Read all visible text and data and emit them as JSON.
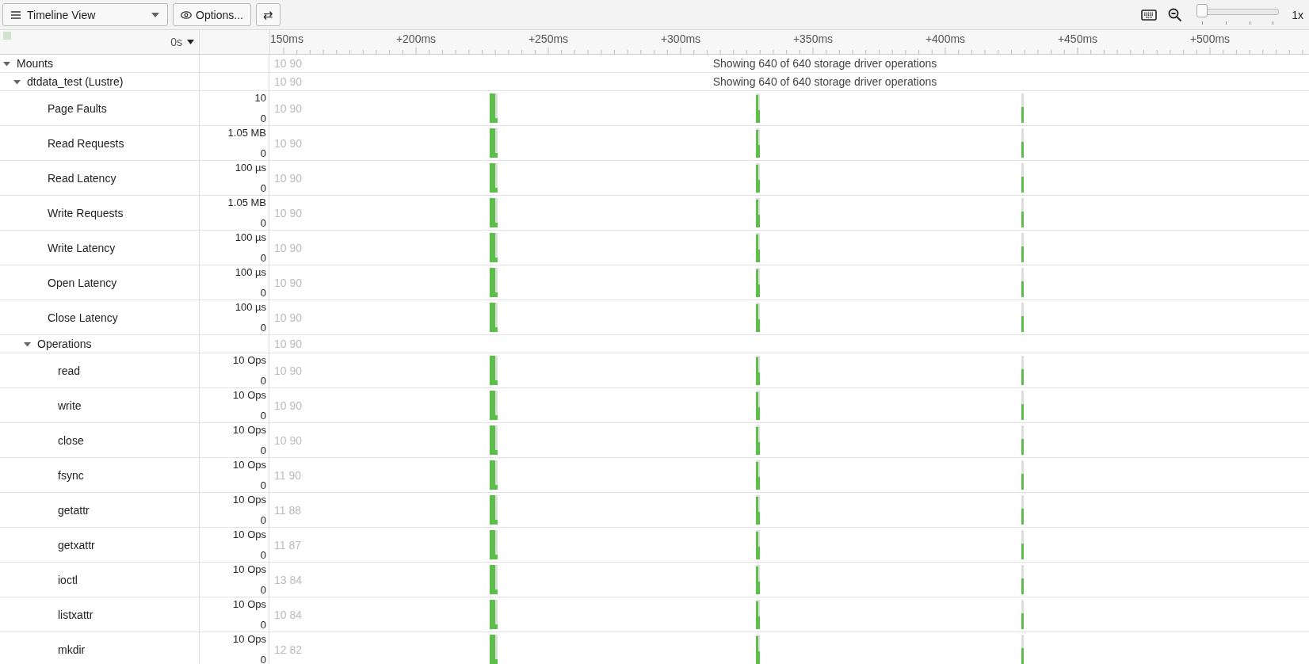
{
  "toolbar": {
    "view_select": "Timeline View",
    "options_button": "Options...",
    "swap_button": "⇄",
    "zoom": {
      "level": 0,
      "reading": "1x"
    }
  },
  "header": {
    "time": "0s",
    "ruler": [
      "150ms",
      "+200ms",
      "+250ms",
      "+300ms",
      "+350ms",
      "+400ms",
      "+450ms",
      "+500ms"
    ]
  },
  "tree": [
    {
      "label": "Mounts",
      "kind": "group",
      "expanded": true,
      "counts": "10 90",
      "message": "Showing 640 of 640 storage driver operations",
      "children": [
        {
          "label": "dtdata_test (Lustre)",
          "kind": "group",
          "expanded": true,
          "counts": "10 90",
          "message": "Showing 640 of 640 storage driver operations",
          "children": [
            {
              "label": "Page Faults",
              "kind": "track",
              "scale_max": "10",
              "scale_min": "0",
              "counts": "10 90"
            },
            {
              "label": "Read Requests",
              "kind": "track",
              "scale_max": "1.05 MB",
              "scale_min": "0",
              "counts": "10 90"
            },
            {
              "label": "Read Latency",
              "kind": "track",
              "scale_max": "100 µs",
              "scale_min": "0",
              "counts": "10 90"
            },
            {
              "label": "Write Requests",
              "kind": "track",
              "scale_max": "1.05 MB",
              "scale_min": "0",
              "counts": "10 90"
            },
            {
              "label": "Write Latency",
              "kind": "track",
              "scale_max": "100 µs",
              "scale_min": "0",
              "counts": "10 90"
            },
            {
              "label": "Open Latency",
              "kind": "track",
              "scale_max": "100 µs",
              "scale_min": "0",
              "counts": "10 90"
            },
            {
              "label": "Close Latency",
              "kind": "track",
              "scale_max": "100 µs",
              "scale_min": "0",
              "counts": "10 90"
            },
            {
              "label": "Operations",
              "kind": "group",
              "expanded": true,
              "counts": "10 90",
              "children": [
                {
                  "label": "read",
                  "kind": "track",
                  "scale_max": "10 Ops",
                  "scale_min": "0",
                  "counts": "10 90"
                },
                {
                  "label": "write",
                  "kind": "track",
                  "scale_max": "10 Ops",
                  "scale_min": "0",
                  "counts": "10 90"
                },
                {
                  "label": "close",
                  "kind": "track",
                  "scale_max": "10 Ops",
                  "scale_min": "0",
                  "counts": "10 90"
                },
                {
                  "label": "fsync",
                  "kind": "track",
                  "scale_max": "10 Ops",
                  "scale_min": "0",
                  "counts": "11 90"
                },
                {
                  "label": "getattr",
                  "kind": "track",
                  "scale_max": "10 Ops",
                  "scale_min": "0",
                  "counts": "11 88"
                },
                {
                  "label": "getxattr",
                  "kind": "track",
                  "scale_max": "10 Ops",
                  "scale_min": "0",
                  "counts": "11 87"
                },
                {
                  "label": "ioctl",
                  "kind": "track",
                  "scale_max": "10 Ops",
                  "scale_min": "0",
                  "counts": "13 84"
                },
                {
                  "label": "listxattr",
                  "kind": "track",
                  "scale_max": "10 Ops",
                  "scale_min": "0",
                  "counts": "10 84"
                },
                {
                  "label": "mkdir",
                  "kind": "track",
                  "scale_max": "10 Ops",
                  "scale_min": "0",
                  "counts": "12 82"
                }
              ]
            }
          ]
        }
      ]
    }
  ]
}
